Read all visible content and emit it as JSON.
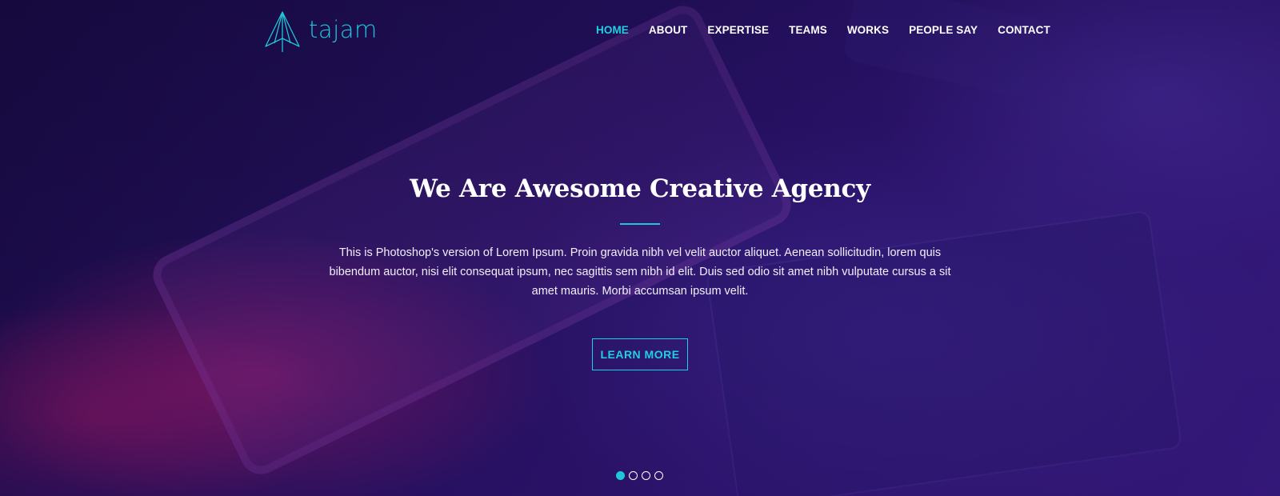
{
  "brand": {
    "name": "tajam",
    "logo_icon": "paper-plane-triangle-icon",
    "accent_color": "#1fc6d8"
  },
  "nav": {
    "items": [
      {
        "label": "HOME",
        "active": true
      },
      {
        "label": "ABOUT",
        "active": false
      },
      {
        "label": "EXPERTISE",
        "active": false
      },
      {
        "label": "TEAMS",
        "active": false
      },
      {
        "label": "WORKS",
        "active": false
      },
      {
        "label": "PEOPLE SAY",
        "active": false
      },
      {
        "label": "CONTACT",
        "active": false
      }
    ]
  },
  "hero": {
    "title": "We Are Awesome Creative Agency",
    "description": "This is Photoshop's version  of Lorem Ipsum. Proin gravida nibh vel velit auctor aliquet. Aenean sollicitudin, lorem quis bibendum auctor, nisi elit consequat ipsum, nec sagittis sem nibh id elit. Duis sed odio sit amet nibh vulputate cursus a sit amet mauris. Morbi accumsan ipsum velit.",
    "button_label": "LEARN MORE"
  },
  "slider": {
    "count": 4,
    "active_index": 0
  }
}
